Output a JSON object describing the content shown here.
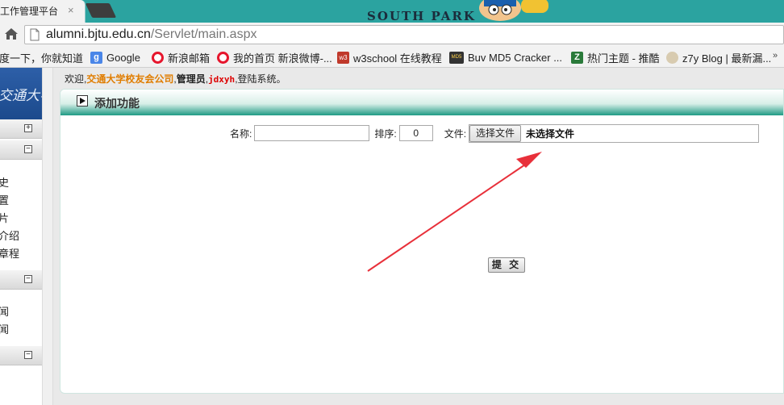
{
  "browser": {
    "tab_title": "工作管理平台",
    "tab_close": "×",
    "url_host": "alumni.bjtu.edu.cn",
    "url_path": "/Servlet/main.aspx"
  },
  "bookmarks": [
    {
      "label": "百度一下，你就知道",
      "icon": "baidu-icon",
      "color": "#2932e1"
    },
    {
      "label": "Google",
      "icon": "google-icon",
      "color": "#4a86e8"
    },
    {
      "label": "新浪邮箱",
      "icon": "sina-icon",
      "color": "#e6162d"
    },
    {
      "label": "我的首页 新浪微博-...",
      "icon": "weibo-icon",
      "color": "#e6162d"
    },
    {
      "label": "w3school 在线教程",
      "icon": "w3school-icon",
      "color": "#c0392b"
    },
    {
      "label": "Buv MD5 Cracker ...",
      "icon": "md5-icon",
      "color": "#444444"
    },
    {
      "label": "热门主题 - 推酷",
      "icon": "tuicool-icon",
      "color": "#2a7a3a"
    },
    {
      "label": "z7y Blog | 最新漏...",
      "icon": "z7y-icon",
      "color": "#c8b89a"
    }
  ],
  "sidebar": {
    "logo_text": "交通大学",
    "groups": [
      {
        "toggle": "+",
        "items": []
      },
      {
        "toggle": "−",
        "items": [
          "史",
          "置",
          "片",
          "介绍",
          "章程"
        ]
      },
      {
        "toggle": "−",
        "items": [
          "闻",
          "闻"
        ]
      },
      {
        "toggle": "−",
        "items": []
      }
    ]
  },
  "welcome": {
    "prefix": "欢迎,",
    "company": "交通大学校友会公司",
    "sep1": ",",
    "role": "管理员",
    "sep2": ",",
    "user": "jdxyh",
    "suffix": ",登陆系统。"
  },
  "panel": {
    "title": "添加功能",
    "name_label": "名称:",
    "name_value": "",
    "sort_label": "排序:",
    "sort_value": "0",
    "file_label": "文件:",
    "file_button": "选择文件",
    "file_status": "未选择文件",
    "submit_label": "提 交"
  },
  "colors": {
    "tab_strip": "#2ba3a0",
    "panel_header_accent": "#1f9a84",
    "company_highlight": "#e07d00",
    "username": "#dd0000",
    "annotation_arrow": "#e8303a"
  }
}
